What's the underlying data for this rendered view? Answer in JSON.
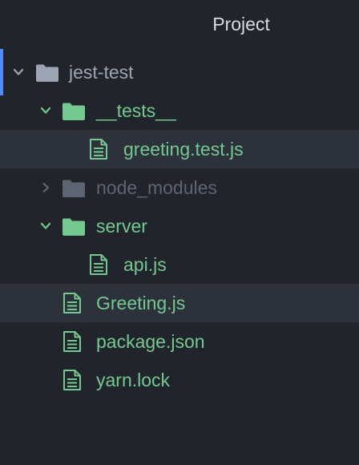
{
  "panel": {
    "title": "Project"
  },
  "colors": {
    "background": "#21252b",
    "selected_row": "#2c313a",
    "accent": "#568af2",
    "added_green": "#73c990",
    "ignored_gray": "#5e6572",
    "root_text": "#9da5b4"
  },
  "tree": {
    "root": {
      "label": "jest-test",
      "expanded": true,
      "icon": "folder-icon"
    },
    "tests_folder": {
      "label": "__tests__",
      "expanded": true,
      "icon": "folder-icon"
    },
    "greeting_test_file": {
      "label": "greeting.test.js",
      "selected": true,
      "icon": "file-text-icon"
    },
    "node_modules_folder": {
      "label": "node_modules",
      "expanded": false,
      "icon": "folder-icon"
    },
    "server_folder": {
      "label": "server",
      "expanded": true,
      "icon": "folder-icon"
    },
    "api_file": {
      "label": "api.js",
      "icon": "file-text-icon"
    },
    "greeting_file": {
      "label": "Greeting.js",
      "selected": true,
      "icon": "file-text-icon"
    },
    "package_json_file": {
      "label": "package.json",
      "icon": "file-text-icon"
    },
    "yarn_lock_file": {
      "label": "yarn.lock",
      "icon": "file-text-icon"
    }
  }
}
